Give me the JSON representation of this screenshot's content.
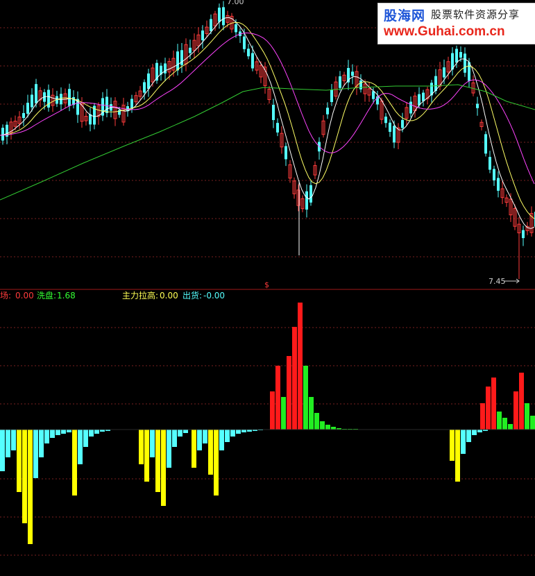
{
  "indicators": {
    "label_1": "退场:",
    "value_1": "0.00",
    "label_2": "洗盘:",
    "value_2": "1.68",
    "label_3": "主力拉高:",
    "value_3": "0.00",
    "label_4": "出货:",
    "value_4": "-0.00"
  },
  "price_labels": {
    "high": "7.00",
    "low": "7.45"
  },
  "signal_marker": "$",
  "watermark": {
    "logo": "股海网",
    "tagline": "股票软件资源分享",
    "url": "www.Guhai.com.cn"
  },
  "colors": {
    "up_candle": "#ff3b3b",
    "down_candle": "#55ffff",
    "ma_short": "#ffffff",
    "ma_mid": "#ffff66",
    "ma_long": "#ff44ff",
    "ma_slow": "#33cc33",
    "bar_red": "#ff1a1a",
    "bar_green": "#22ee22",
    "bar_yellow": "#ffff00",
    "bar_cyan": "#55ffff",
    "grid": "#7a1f1f"
  },
  "chart_data": {
    "type": "bar",
    "price_panel": {
      "candles_shown": true,
      "moving_average_lines": [
        "white",
        "yellow",
        "magenta",
        "green"
      ]
    },
    "indicator_bars_upper": [
      {
        "color": "red",
        "values": [
          0,
          0,
          0,
          0,
          0,
          0,
          0,
          0,
          0,
          0,
          0,
          0,
          0,
          0,
          0,
          0,
          0,
          0,
          0,
          0,
          0,
          0,
          0,
          0,
          0,
          0,
          0,
          0,
          0,
          0,
          0,
          0,
          0,
          0,
          0,
          0,
          0,
          0,
          0,
          0,
          0,
          0,
          0,
          0,
          0,
          0,
          0,
          0,
          0,
          0,
          0,
          0,
          0,
          0,
          0,
          0,
          0,
          0,
          0,
          0,
          0,
          0,
          0,
          0,
          0,
          0,
          0,
          0,
          0,
          0,
          0,
          0,
          0,
          0,
          0,
          0,
          0,
          0,
          0,
          0,
          0,
          0,
          0,
          0,
          0,
          0,
          0,
          0,
          0,
          0,
          0,
          0,
          0,
          0,
          0,
          0,
          0,
          0,
          0,
          0,
          0,
          0,
          0,
          0,
          0,
          0,
          0,
          0,
          0,
          0,
          0,
          0,
          0,
          0,
          0,
          0,
          0,
          0,
          0,
          0,
          0,
          0,
          0,
          0,
          0,
          0,
          0,
          0,
          0,
          0
        ]
      }
    ]
  }
}
